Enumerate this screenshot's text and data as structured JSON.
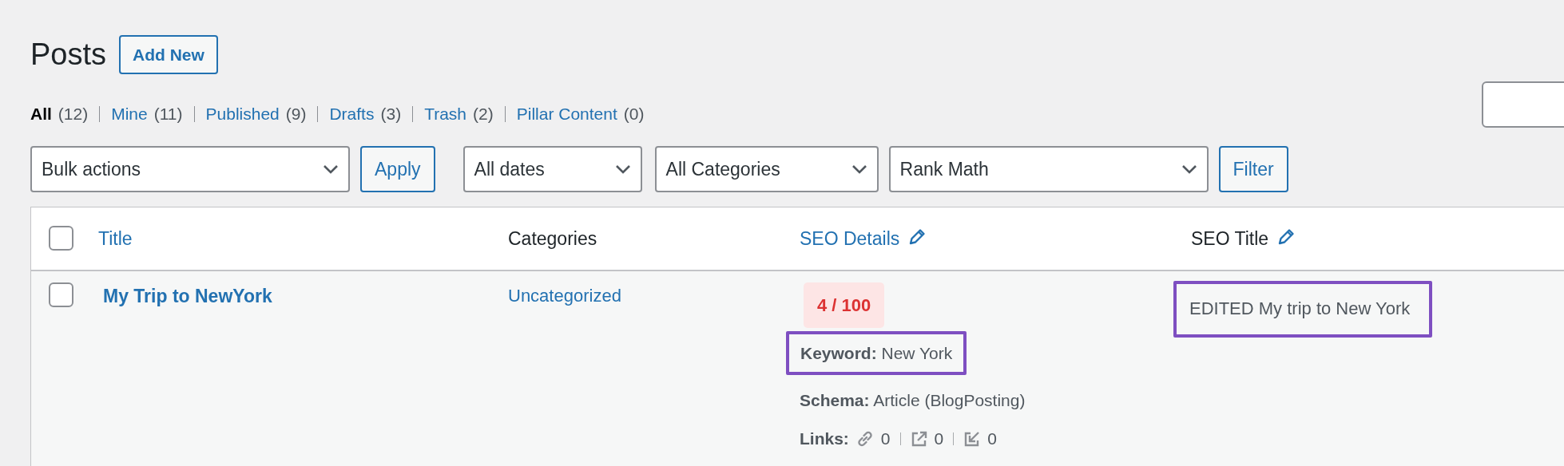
{
  "page": {
    "title": "Posts",
    "add_new_button": "Add New"
  },
  "views": [
    {
      "label": "All",
      "count": "(12)",
      "selected": true
    },
    {
      "label": "Mine",
      "count": "(11)",
      "selected": false
    },
    {
      "label": "Published",
      "count": "(9)",
      "selected": false
    },
    {
      "label": "Drafts",
      "count": "(3)",
      "selected": false
    },
    {
      "label": "Trash",
      "count": "(2)",
      "selected": false
    },
    {
      "label": "Pillar Content",
      "count": "(0)",
      "selected": false
    }
  ],
  "filters": {
    "bulk_actions": "Bulk actions",
    "apply_button": "Apply",
    "dates": "All dates",
    "categories": "All Categories",
    "seo": "Rank Math",
    "filter_button": "Filter"
  },
  "table": {
    "select_all_checked": false,
    "columns": [
      {
        "label": "Title",
        "link": true,
        "editable": false
      },
      {
        "label": "Categories",
        "link": false,
        "editable": false
      },
      {
        "label": "SEO Details",
        "link": true,
        "editable": true
      },
      {
        "label": "SEO Title",
        "link": false,
        "editable": true
      }
    ],
    "rows": [
      {
        "checked": false,
        "title": "My Trip to NewYork",
        "category": "Uncategorized",
        "score": "4 / 100",
        "keyword": "**Keyword:** New York",
        "keyword_highlighted": true,
        "schema": "**Schema:** Article (BlogPosting)",
        "links_label": "Links:",
        "links": [
          {
            "kind": "internal",
            "count": "0"
          },
          {
            "kind": "external",
            "count": "0"
          },
          {
            "kind": "incoming",
            "count": "0"
          }
        ],
        "seo_title": "EDITED My trip to New York",
        "seo_title_highlighted": true
      }
    ]
  }
}
